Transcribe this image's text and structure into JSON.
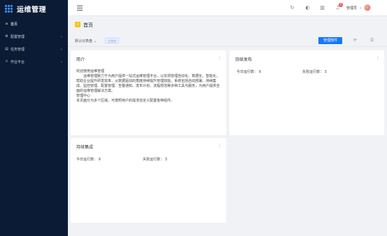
{
  "sidebar": {
    "brand_title": "运维管理",
    "items": [
      {
        "label": "首页",
        "icon": "home-icon",
        "has_children": false
      },
      {
        "label": "配置管理",
        "icon": "settings-icon",
        "has_children": true
      },
      {
        "label": "任务管理",
        "icon": "task-icon",
        "has_children": true
      },
      {
        "label": "作业平台",
        "icon": "job-icon",
        "has_children": true
      }
    ]
  },
  "topbar": {
    "notification_count": "6",
    "user_name": "管理员"
  },
  "page": {
    "title": "首页"
  },
  "toolbar": {
    "dashboard_select": "默认仪表盘",
    "dashboard_tag": "工作台",
    "manage_button": "管理部件"
  },
  "cards": {
    "intro": {
      "title": "简介",
      "lines": [
        "欢迎使用运维管理",
        "运维管理致力于为用户提供一站式运维管理平台，以实现管理自动化、数据化、智能化，帮助企业提升研发效率，从数据驱动的角度持续提升管理效能。系统包括自动部署、持续集成、监控管理、配置管理、告警通知、发布计划、流程规范等多种工具与服务，为用户提供全面的运维管理解决方案。",
        "管理中心",
        "本页面分为多个区域，可按照用户的需求自定义配置各种组件。"
      ]
    },
    "release": {
      "title": "持续发布",
      "today_label": "今日运行数：",
      "today_value": "9",
      "fail_label": "失败运行数：",
      "fail_value": "3"
    },
    "integration": {
      "title": "持续集成",
      "today_label": "今日运行数：",
      "today_value": "9",
      "fail_label": "失败运行数：",
      "fail_value": "3"
    }
  },
  "colors": {
    "sidebar_bg": "#0b1b35",
    "primary": "#1677ff",
    "badge": "#f04b4b",
    "home_badge": "#f5c518"
  }
}
